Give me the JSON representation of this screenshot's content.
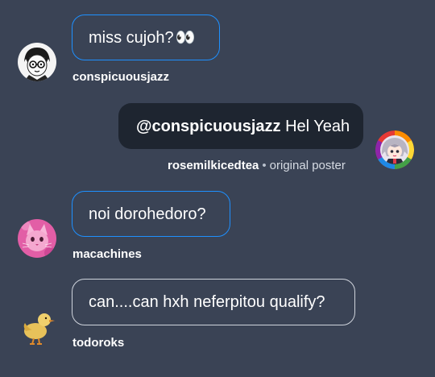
{
  "messages": [
    {
      "text_prefix": "miss cujoh? ",
      "emoji": "👀",
      "username": "conspicuousjazz",
      "avatar_icon": "manga-character-glasses-avatar"
    },
    {
      "mention": "@conspicuousjazz",
      "text": " Hel Yeah",
      "username": "rosemilkicedtea",
      "role_separator": "•",
      "role": "original poster",
      "avatar_icon": "rainbow-ring-anime-girl-avatar"
    },
    {
      "text": "noi dorohedoro?",
      "username": "macachines",
      "avatar_icon": "pink-cat-avatar"
    },
    {
      "text": "can....can hxh neferpitou qualify?",
      "username": "todoroks",
      "avatar_icon": "duckling-avatar"
    }
  ],
  "colors": {
    "background": "#3a4355",
    "accent_border": "#1e90ff",
    "op_bubble": "#1e2530",
    "grey_border": "#cfd4dc"
  }
}
